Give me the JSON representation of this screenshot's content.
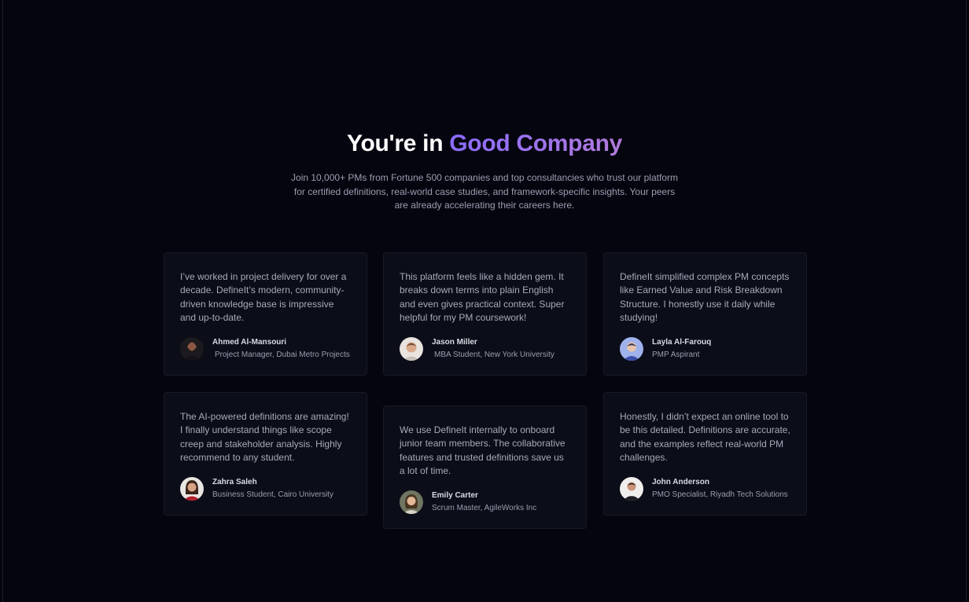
{
  "section": {
    "title_prefix": "You're in ",
    "title_accent": "Good Company",
    "intro": "Join 10,000+ PMs from Fortune 500 companies and top consultancies who trust our platform for certified definitions, real-world case studies, and framework-specific insights. Your peers are already accelerating their careers here."
  },
  "testimonials": [
    {
      "quote": "I’ve worked in project delivery for over a decade. DefineIt’s modern, community-driven knowledge base is impressive and up-to-date.",
      "name": "Ahmed Al-Mansouri",
      "role": "Project Manager, Dubai Metro Projects",
      "avatar_icon": "avatar-man-beard-icon"
    },
    {
      "quote": "This platform feels like a hidden gem. It breaks down terms into plain English and even gives practical context. Super helpful for my PM coursework!",
      "name": "Jason Miller",
      "role": "MBA Student, New York University",
      "avatar_icon": "avatar-man-light-icon"
    },
    {
      "quote": "DefineIt simplified complex PM concepts like Earned Value and Risk Breakdown Structure. I honestly use it daily while studying!",
      "name": "Layla Al-Farouq",
      "role": "PMP Aspirant",
      "avatar_icon": "avatar-person-blue-icon"
    },
    {
      "quote": "The AI-powered definitions are amazing! I finally understand things like scope creep and stakeholder analysis. Highly recommend to any student.",
      "name": "Zahra Saleh",
      "role": "Business Student, Cairo University",
      "avatar_icon": "avatar-woman-red-icon"
    },
    {
      "quote": "We use DefineIt internally to onboard junior team members. The collaborative features and trusted definitions save us a lot of time.",
      "name": "Emily Carter",
      "role": "Scrum Master, AgileWorks Inc",
      "avatar_icon": "avatar-woman-outdoor-icon"
    },
    {
      "quote": "Honestly, I didn’t expect an online tool to be this detailed. Definitions are accurate, and the examples reflect real-world PM challenges.",
      "name": "John Anderson",
      "role": "PMO Specialist, Riyadh Tech Solutions",
      "avatar_icon": "avatar-man-suit-icon"
    }
  ],
  "colors": {
    "background": "#05050f",
    "card": "#0b0d18",
    "accent_start": "#8a6cff",
    "accent_end": "#b07ad8"
  }
}
